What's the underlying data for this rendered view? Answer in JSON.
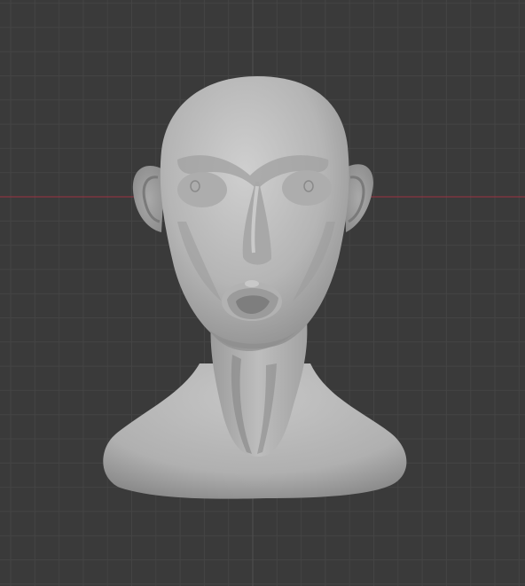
{
  "viewport": {
    "background": "#3a3a3a",
    "grid_minor_color": "#444444",
    "grid_major_color": "#4d4d4d",
    "x_axis_color": "#8b3442"
  },
  "model": {
    "kind": "sculpted-head-bust",
    "shading": "solid",
    "base_color": "#b9b9b9",
    "shadow_color": "#7a7a7a",
    "highlight_color": "#d4d4d4"
  }
}
